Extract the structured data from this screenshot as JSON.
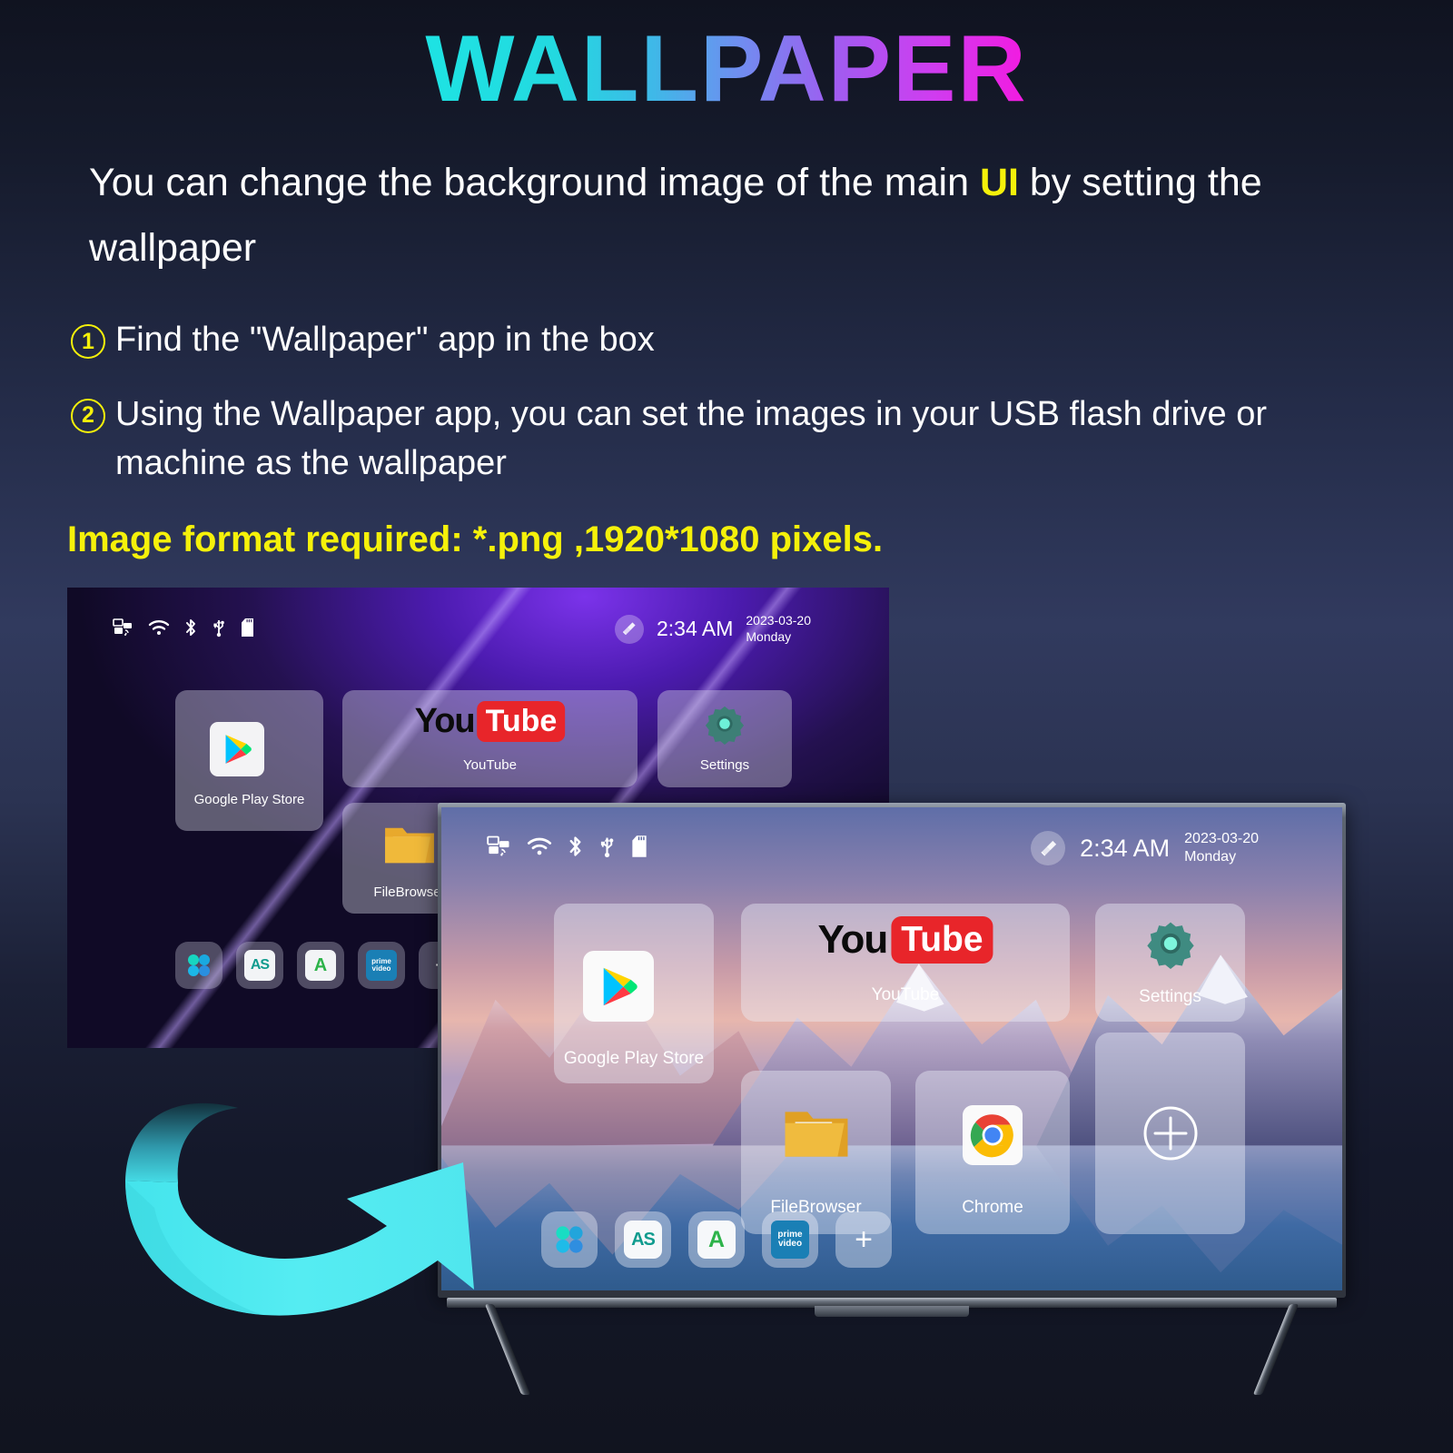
{
  "header": {
    "title": "WALLPAPER"
  },
  "intro": {
    "part1": "You can change the background image of the main ",
    "highlight": "UI",
    "part2": " by setting the wallpaper"
  },
  "steps": [
    {
      "num": "1",
      "text": "Find the \"Wallpaper\" app in the box"
    },
    {
      "num": "2",
      "text": "Using the Wallpaper app, you can set the images in your USB flash drive or machine as the wallpaper"
    }
  ],
  "format_note": "Image format required: *.png ,1920*1080 pixels.",
  "back_screen": {
    "status_icons": [
      "ethernet-icon",
      "wifi-icon",
      "bluetooth-icon",
      "usb-icon",
      "sdcard-icon"
    ],
    "cleaner_icon": "broom-icon",
    "time": "2:34 AM",
    "date": "2023-03-20",
    "weekday": "Monday",
    "tiles": [
      {
        "label": "Google Play Store",
        "icon": "google-play-icon"
      },
      {
        "label": "YouTube",
        "icon": "youtube-icon"
      },
      {
        "label": "Settings",
        "icon": "gear-icon"
      },
      {
        "label": "FileBrowser",
        "icon": "folder-icon"
      }
    ],
    "dock": [
      {
        "icon": "apps-grid-icon",
        "label": ""
      },
      {
        "icon": "as-store-icon",
        "label": "AS"
      },
      {
        "icon": "aptoide-icon",
        "label": "A"
      },
      {
        "icon": "prime-video-icon",
        "label": "prime video"
      },
      {
        "icon": "plus-icon",
        "label": "+"
      }
    ]
  },
  "tv_screen": {
    "status_icons": [
      "ethernet-icon",
      "wifi-icon",
      "bluetooth-icon",
      "usb-icon",
      "sdcard-icon"
    ],
    "cleaner_icon": "broom-icon",
    "time": "2:34 AM",
    "date": "2023-03-20",
    "weekday": "Monday",
    "tiles": [
      {
        "label": "Google Play Store",
        "icon": "google-play-icon"
      },
      {
        "label": "YouTube",
        "icon": "youtube-icon"
      },
      {
        "label": "Settings",
        "icon": "gear-icon"
      },
      {
        "label": "FileBrowser",
        "icon": "folder-icon"
      },
      {
        "label": "Chrome",
        "icon": "chrome-icon"
      },
      {
        "label": "",
        "icon": "add-circle-icon"
      }
    ],
    "dock": [
      {
        "icon": "apps-grid-icon",
        "label": ""
      },
      {
        "icon": "as-store-icon",
        "label": "AS"
      },
      {
        "icon": "aptoide-icon",
        "label": "A"
      },
      {
        "icon": "prime-video-icon",
        "label": "prime video"
      },
      {
        "icon": "plus-icon",
        "label": "+"
      }
    ]
  },
  "arrow": {
    "icon": "curved-arrow-right-icon"
  },
  "colors": {
    "accent_yellow": "#f5f10a",
    "arrow_cyan": "#4fe9ee",
    "title_start": "#1ee3e3",
    "title_end": "#f31ae0",
    "background_dark": "#101320"
  }
}
